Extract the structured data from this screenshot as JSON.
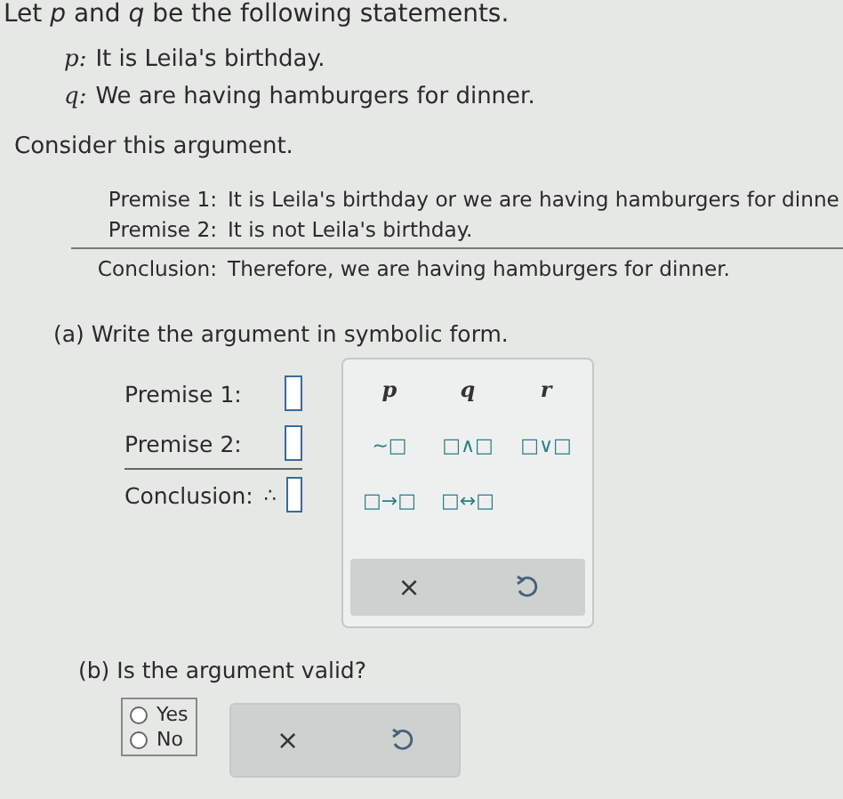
{
  "intro": "Let *p* and *q* be the following statements.",
  "statements": [
    {
      "variable": "p:",
      "text": "It is Leila's birthday."
    },
    {
      "variable": "q:",
      "text": "We are having hamburgers for dinner."
    }
  ],
  "consider": "Consider this argument.",
  "argument": [
    {
      "label": "Premise 1:",
      "text": "It is Leila's birthday or we are having hamburgers for dinne"
    },
    {
      "label": "Premise 2:",
      "text": "It is not Leila's birthday."
    },
    {
      "label": "Conclusion:",
      "text": "Therefore, we are having hamburgers for dinner."
    }
  ],
  "part_a": {
    "prompt": "(a) Write the argument in symbolic form.",
    "rows": [
      {
        "label": "Premise 1:"
      },
      {
        "label": "Premise 2:"
      },
      {
        "label": "Conclusion:",
        "prefix": "∴"
      }
    ]
  },
  "keypad": {
    "variables": [
      "p",
      "q",
      "r"
    ],
    "operators": [
      "~□",
      "□∧□",
      "□∨□",
      "□→□",
      "□↔□"
    ],
    "clear": "×"
  },
  "part_b": {
    "prompt": "(b) Is the argument valid?",
    "options": [
      {
        "label": "Yes",
        "selected": false
      },
      {
        "label": "No",
        "selected": false
      }
    ],
    "clear": "×"
  }
}
